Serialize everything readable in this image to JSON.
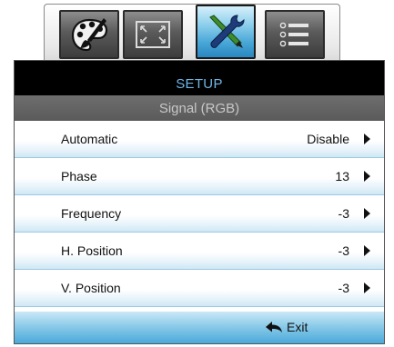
{
  "tabs": [
    {
      "id": "image",
      "icon": "palette-icon",
      "active": false
    },
    {
      "id": "display",
      "icon": "fullscreen-icon",
      "active": false
    },
    {
      "id": "setup",
      "icon": "tools-icon",
      "active": true
    },
    {
      "id": "options",
      "icon": "list-icon",
      "active": false
    }
  ],
  "menu": {
    "title": "SETUP",
    "subtitle": "Signal (RGB)",
    "items": [
      {
        "label": "Automatic",
        "value": "Disable"
      },
      {
        "label": "Phase",
        "value": "13"
      },
      {
        "label": "Frequency",
        "value": "-3"
      },
      {
        "label": "H. Position",
        "value": "-3"
      },
      {
        "label": "V. Position",
        "value": "-3"
      }
    ],
    "exit_label": "Exit"
  },
  "colors": {
    "title_text": "#6fb6e6",
    "accent": "#4aa9da"
  }
}
